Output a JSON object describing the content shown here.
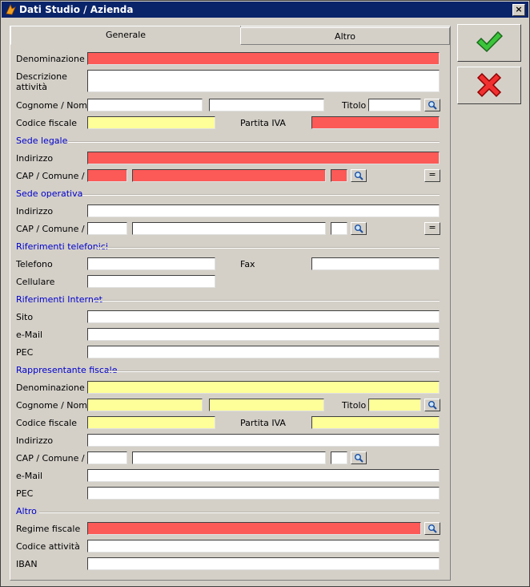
{
  "window": {
    "title": "Dati Studio / Azienda",
    "close": "×"
  },
  "tabs": [
    {
      "label": "Generale"
    },
    {
      "label": "Altro"
    }
  ],
  "fields": {
    "denominazione": "Denominazione",
    "descrizione": "Descrizione attività",
    "cognome_nome": "Cognome / Nome",
    "titolo": "Titolo",
    "codice_fiscale": "Codice fiscale",
    "partita_iva": "Partita IVA",
    "indirizzo": "Indirizzo",
    "cap_comune_pr": "CAP / Comune / PR",
    "telefono": "Telefono",
    "fax": "Fax",
    "cellulare": "Cellulare",
    "sito": "Sito",
    "email": "e-Mail",
    "pec": "PEC",
    "regime_fiscale": "Regime fiscale",
    "codice_attivita": "Codice attività",
    "iban": "IBAN"
  },
  "sections": {
    "sede_legale": "Sede legale",
    "sede_operativa": "Sede operativa",
    "riferimenti_telefonici": "Riferimenti telefonici",
    "riferimenti_internet": "Riferimenti Internet",
    "rappresentante_fiscale": "Rappresentante fiscale",
    "altro": "Altro"
  },
  "buttons": {
    "copy": "="
  },
  "colors": {
    "required": "#fc5a57",
    "optional_highlight": "#ffff99",
    "section_text": "#0000cc",
    "titlebar": "#0a246a"
  },
  "icons": {
    "search": "search-icon",
    "ok": "checkmark-icon",
    "cancel": "cross-icon"
  }
}
